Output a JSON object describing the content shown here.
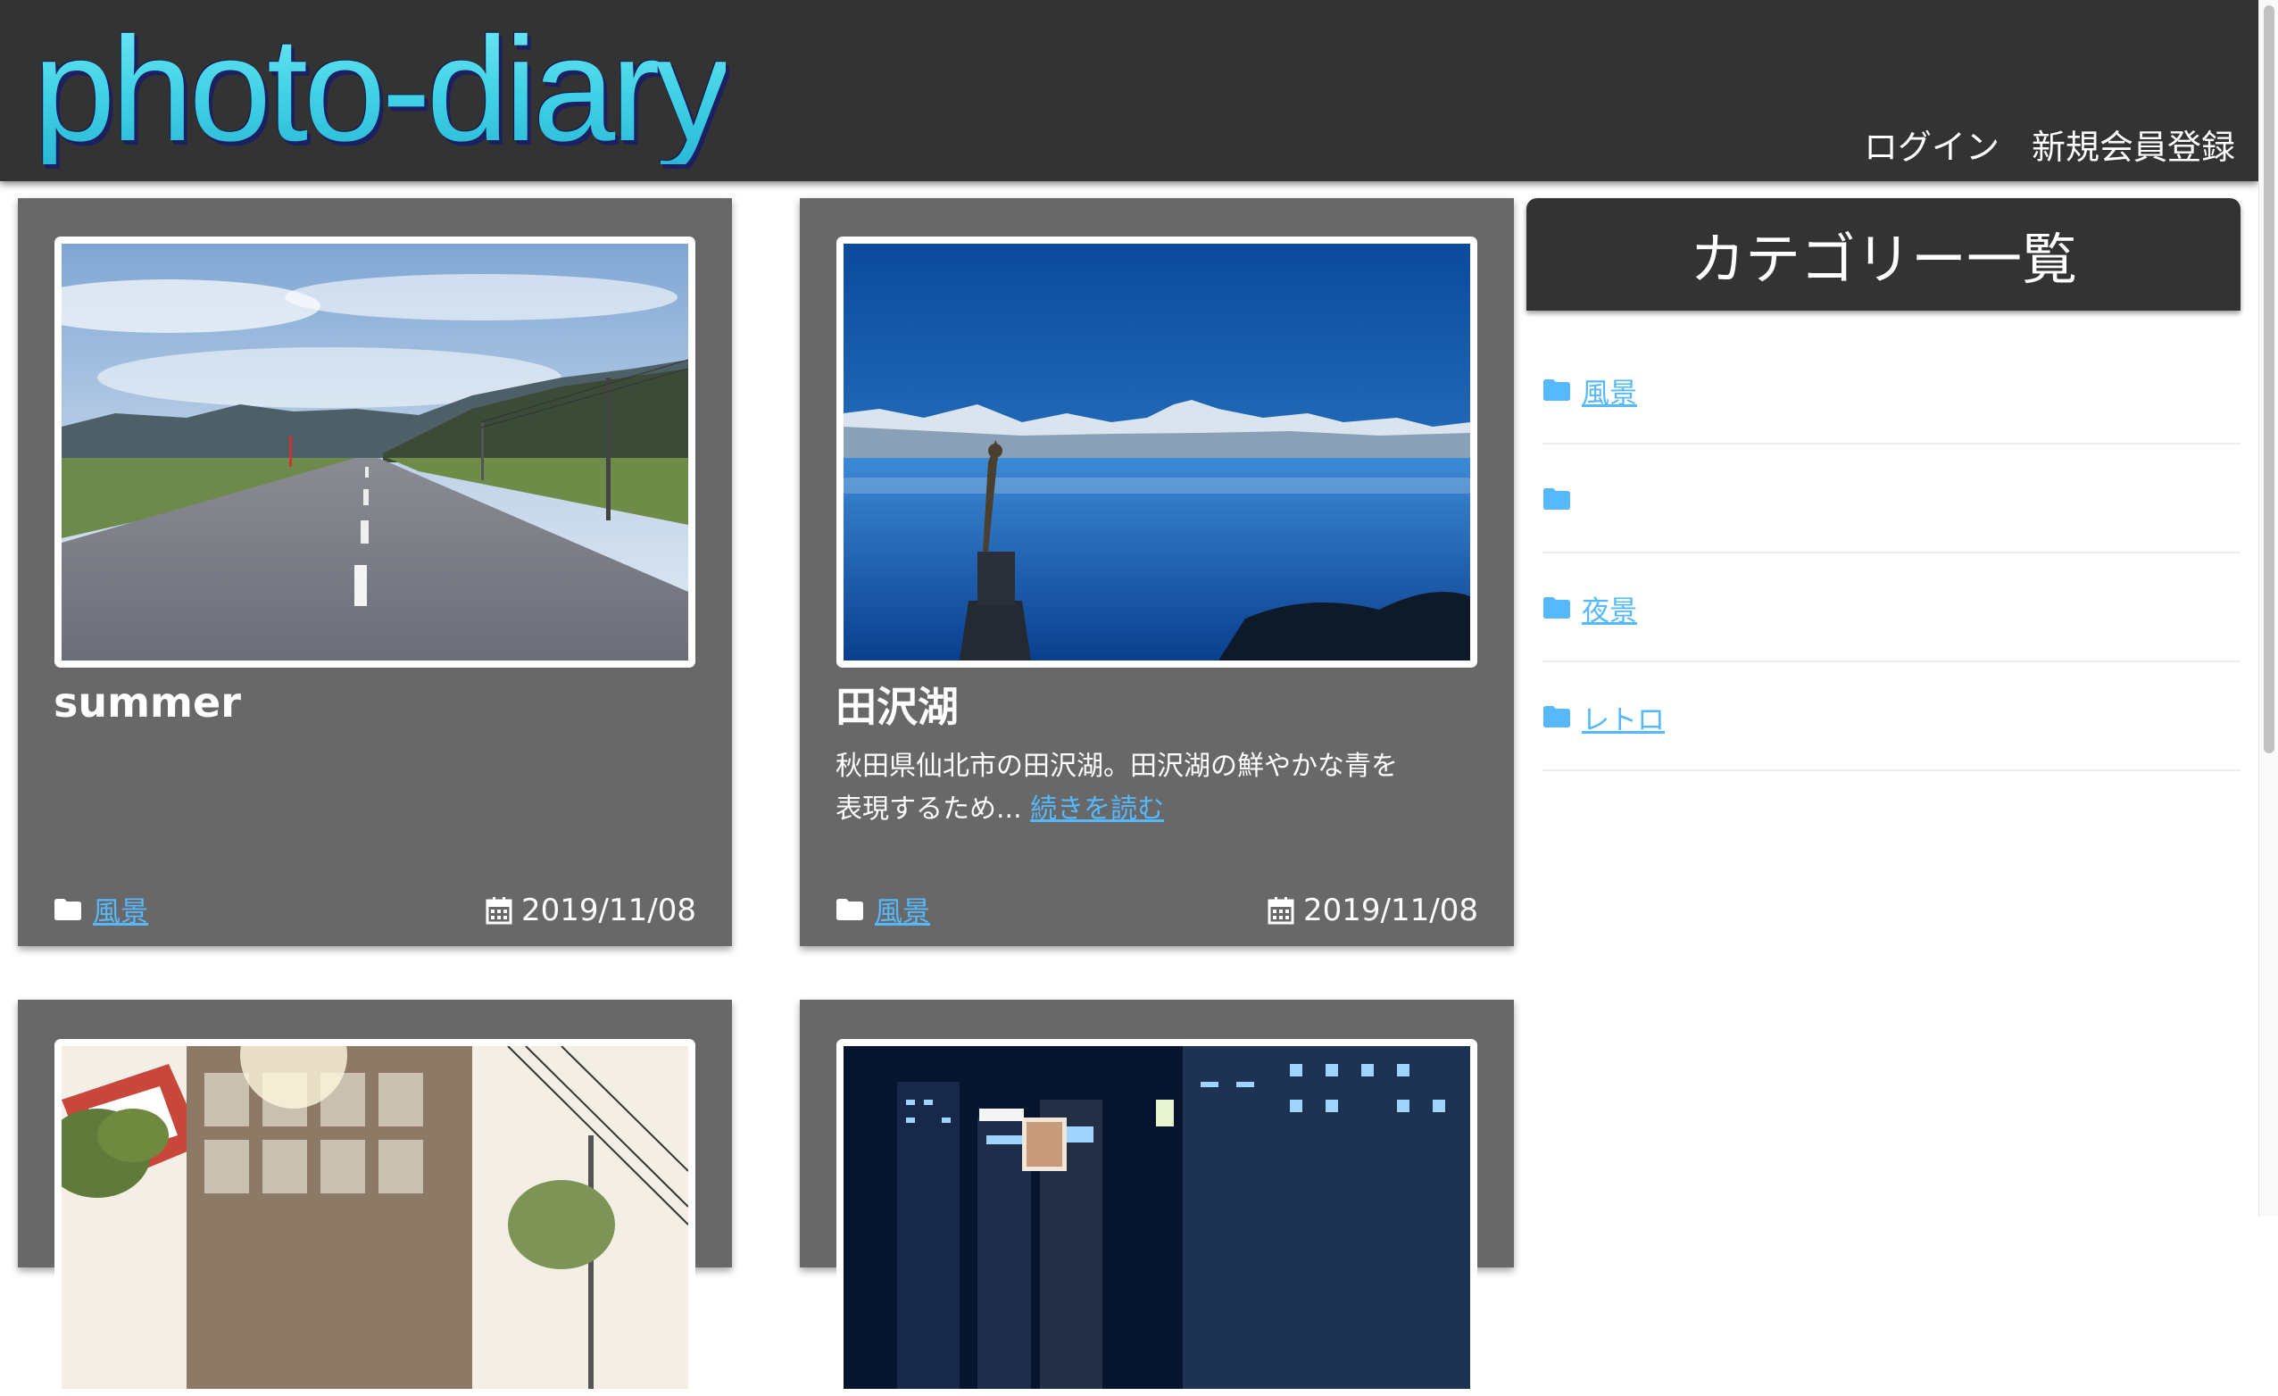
{
  "header": {
    "logo": "photo-diary",
    "nav": {
      "login": "ログイン",
      "register": "新規会員登録"
    }
  },
  "posts": [
    {
      "title": "summer",
      "excerpt": "",
      "read_more": "",
      "category": "風景",
      "date": "2019/11/08",
      "photo": "country-road"
    },
    {
      "title": "田沢湖",
      "excerpt": "秋田県仙北市の田沢湖。田沢湖の鮮やかな青を表現するため...",
      "read_more": "続きを読む",
      "category": "風景",
      "date": "2019/11/08",
      "photo": "lake-statue"
    },
    {
      "photo": "retro-storefront"
    },
    {
      "photo": "night-city"
    }
  ],
  "sidebar": {
    "heading": "カテゴリー一覧",
    "categories": [
      {
        "label": "風景"
      },
      {
        "label": ""
      },
      {
        "label": "夜景"
      },
      {
        "label": "レトロ"
      }
    ]
  },
  "icons": {
    "category": "folder-icon",
    "date": "calendar-icon"
  },
  "colors": {
    "header_bg": "#333333",
    "card_bg": "#686868",
    "link": "#56b8ff",
    "logo_cyan": "#54dcec"
  }
}
